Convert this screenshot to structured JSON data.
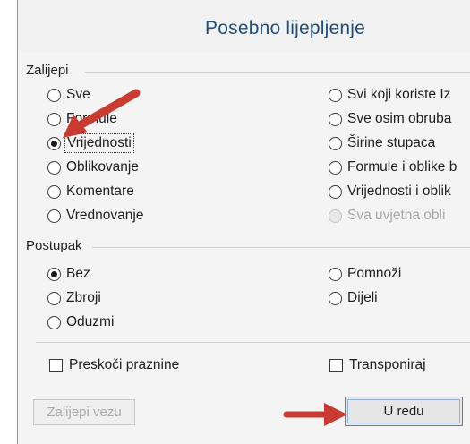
{
  "dialog": {
    "title": "Posebno lijepljenje",
    "paste_section_label": "Zalijepi",
    "paste_options_left": [
      {
        "label": "Sve",
        "checked": false
      },
      {
        "label": "Formule",
        "checked": false
      },
      {
        "label": "Vrijednosti",
        "checked": true
      },
      {
        "label": "Oblikovanje",
        "checked": false
      },
      {
        "label": "Komentare",
        "checked": false
      },
      {
        "label": "Vrednovanje",
        "checked": false
      }
    ],
    "paste_options_right": [
      {
        "label": "Svi koji koriste Iz",
        "checked": false,
        "disabled": false
      },
      {
        "label": "Sve osim obruba",
        "checked": false,
        "disabled": false
      },
      {
        "label": "Širine stupaca",
        "checked": false,
        "disabled": false
      },
      {
        "label": "Formule i oblike b",
        "checked": false,
        "disabled": false
      },
      {
        "label": "Vrijednosti i oblik",
        "checked": false,
        "disabled": false
      },
      {
        "label": "Sva uvjetna obli",
        "checked": false,
        "disabled": true
      }
    ],
    "operation_section_label": "Postupak",
    "operation_options_left": [
      {
        "label": "Bez",
        "checked": true
      },
      {
        "label": "Zbroji",
        "checked": false
      },
      {
        "label": "Oduzmi",
        "checked": false
      }
    ],
    "operation_options_right": [
      {
        "label": "Pomnoži",
        "checked": false
      },
      {
        "label": "Dijeli",
        "checked": false
      }
    ],
    "skip_blanks_label": "Preskoči praznine",
    "transpose_label": "Transponiraj",
    "paste_link_label": "Zalijepi vezu",
    "ok_label": "U redu"
  },
  "colors": {
    "title_text": "#1f4f7d",
    "frame_border": "#6d9bd3",
    "annotation_arrow": "#c93a31"
  }
}
